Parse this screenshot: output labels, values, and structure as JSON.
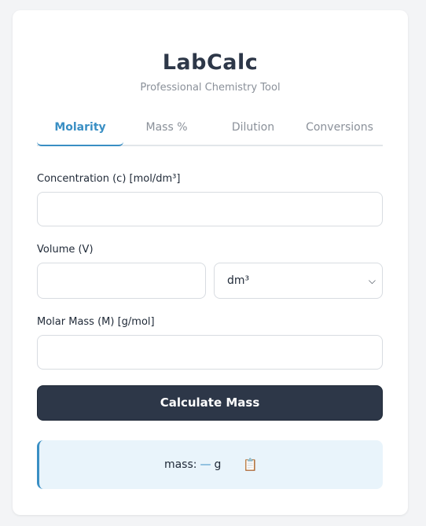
{
  "header": {
    "title": "LabCalc",
    "subtitle": "Professional Chemistry Tool"
  },
  "tabs": [
    {
      "label": "Molarity",
      "active": true
    },
    {
      "label": "Mass %",
      "active": false
    },
    {
      "label": "Dilution",
      "active": false
    },
    {
      "label": "Conversions",
      "active": false
    }
  ],
  "form": {
    "concentration_label": "Concentration (c) [mol/dm³]",
    "concentration_value": "",
    "volume_label": "Volume (V)",
    "volume_value": "",
    "volume_unit": "dm³",
    "molar_mass_label": "Molar Mass (M) [g/mol]",
    "molar_mass_value": "",
    "calculate_label": "Calculate Mass"
  },
  "result": {
    "label": "mass:",
    "value": "—",
    "unit": "g",
    "copy_glyph": "📋"
  },
  "colors": {
    "accent": "#3a8fc4",
    "button": "#2d3748",
    "result_bg": "#e9f4fb"
  }
}
